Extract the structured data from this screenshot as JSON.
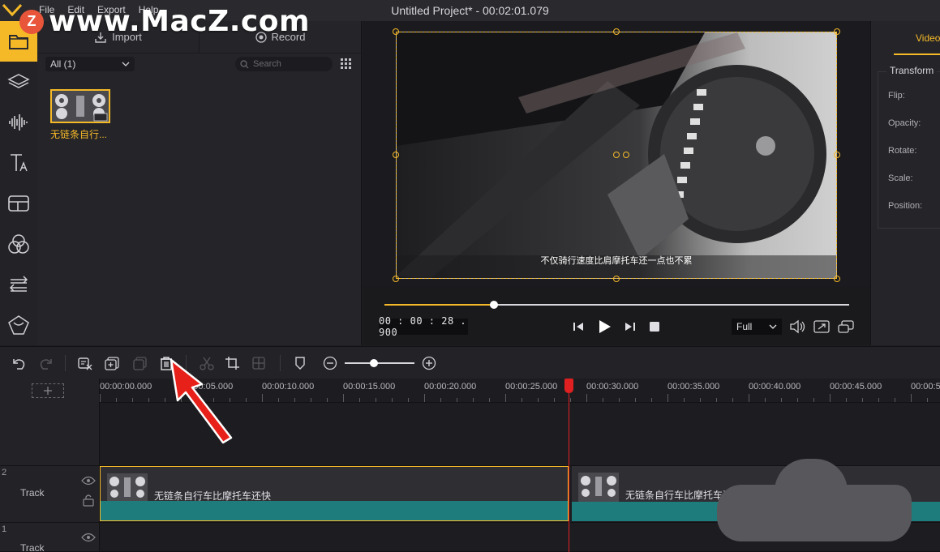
{
  "watermark": {
    "badge": "Z",
    "text": "www.MacZ.com"
  },
  "titlebar": {
    "title": "Untitled Project* - 00:02:01.079",
    "menu": [
      "File",
      "Edit",
      "Export",
      "Help"
    ]
  },
  "rail": {
    "items": [
      {
        "icon": "folder-icon",
        "active": true
      },
      {
        "icon": "layers-icon",
        "active": false
      },
      {
        "icon": "audio-waveform-icon",
        "active": false
      },
      {
        "icon": "text-icon",
        "active": false
      },
      {
        "icon": "template-icon",
        "active": false
      },
      {
        "icon": "filters-icon",
        "active": false
      },
      {
        "icon": "transitions-icon",
        "active": false
      },
      {
        "icon": "sticker-icon",
        "active": false
      }
    ]
  },
  "media": {
    "import_label": "Import",
    "record_label": "Record",
    "filter_value": "All (1)",
    "search_placeholder": "Search",
    "items": [
      {
        "caption": "无链条自行..."
      }
    ]
  },
  "preview": {
    "subtitle": "不仅骑行速度比肩摩托车还一点也不累",
    "progress_fraction": 0.235,
    "timecode": "00 : 00 : 28 . 900",
    "zoom_value": "Full"
  },
  "props": {
    "tab": "Video",
    "section_title": "Transform",
    "labels": [
      "Flip:",
      "Opacity:",
      "Rotate:",
      "Scale:",
      "Position:"
    ]
  },
  "timeline": {
    "zoom_fraction": 0.42,
    "ruler_labels": [
      "00:00:00.000",
      "00:00:05.000",
      "00:00:10.000",
      "00:00:15.000",
      "00:00:20.000",
      "00:00:25.000",
      "00:00:30.000",
      "00:00:35.000",
      "00:00:40.000",
      "00:00:45.000",
      "00:00:5"
    ],
    "tracks": [
      {
        "number": "2",
        "name": "Track"
      },
      {
        "number": "1",
        "name": "Track"
      }
    ],
    "clips": [
      {
        "label": "无链条自行车比摩托车还快",
        "selected": true
      },
      {
        "label": "无链条自行车比摩托车还",
        "selected": false
      }
    ]
  },
  "colors": {
    "accent": "#f5b928",
    "playhead": "#e02020",
    "audio_wave": "#1f7c7c",
    "annotation_arrow": "#e8201a"
  }
}
